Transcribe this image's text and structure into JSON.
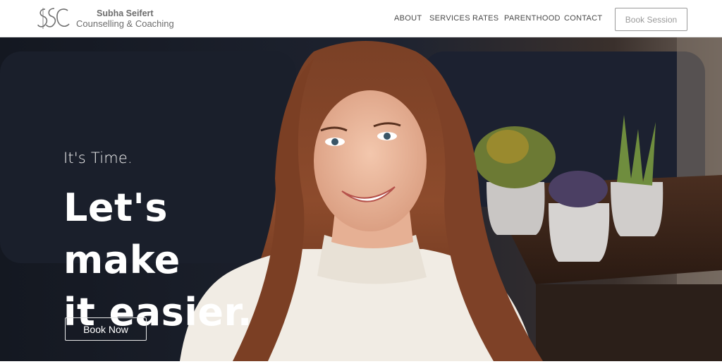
{
  "header": {
    "brand_name": "Subha Seifert",
    "brand_tagline": "Counselling & Coaching",
    "logo_icon": "ssc-monogram-logo",
    "nav": [
      {
        "label": "ABOUT"
      },
      {
        "label": "SERVICES"
      },
      {
        "label": "RATES"
      },
      {
        "label": "PARENTHOOD"
      },
      {
        "label": "CONTACT"
      }
    ],
    "cta_label": "Book Session"
  },
  "hero": {
    "eyebrow": "It's Time.",
    "title_line1": "Let's make",
    "title_line2": "it easier.",
    "cta_label": "Book Now",
    "image_subject": "smiling woman in white turtleneck with plants"
  },
  "colors": {
    "header_bg": "#ffffff",
    "nav_text": "#4a4a4a",
    "hero_bg": "#1b1f2a",
    "hero_text": "#ffffff",
    "accent_button_border": "#9a9a9a"
  }
}
